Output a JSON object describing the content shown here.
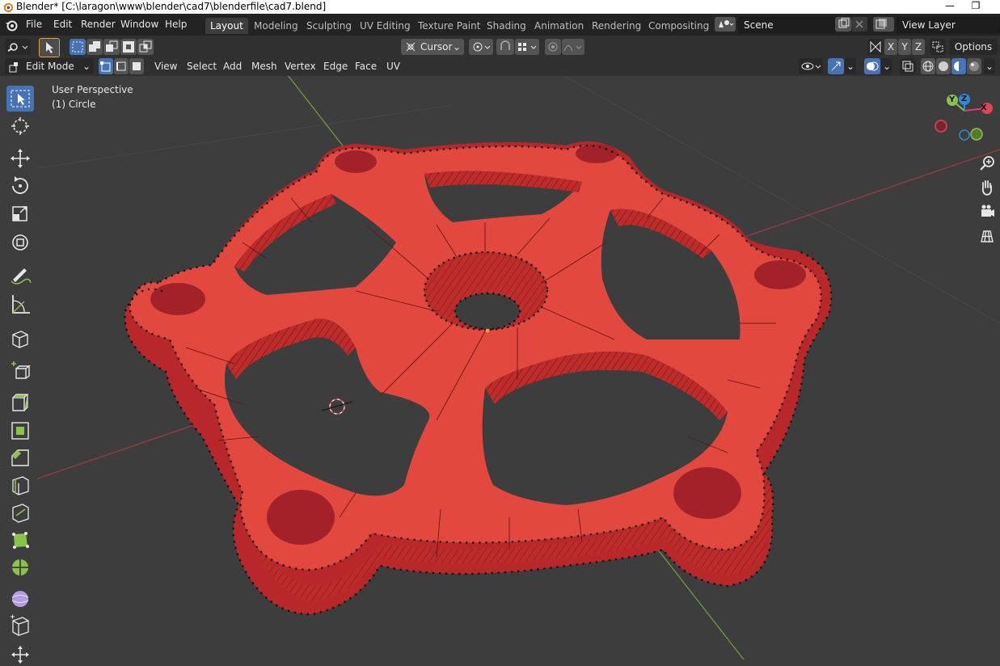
{
  "window": {
    "title": "Blender* [C:\\laragon\\www\\blender\\cad7\\blenderfile\\cad7.blend]",
    "minimize_glyph": "—",
    "maximize_glyph": "❐"
  },
  "menubar": {
    "items": [
      "File",
      "Edit",
      "Render",
      "Window",
      "Help"
    ],
    "workspaces": [
      "Layout",
      "Modeling",
      "Sculpting",
      "UV Editing",
      "Texture Paint",
      "Shading",
      "Animation",
      "Rendering",
      "Compositing"
    ],
    "active_workspace": "Layout",
    "scene": "Scene",
    "view_layer": "View Layer"
  },
  "header": {
    "transform_orientation": "Cursor",
    "axes": [
      "X",
      "Y",
      "Z"
    ],
    "options_label": "Options",
    "mode": "Edit Mode",
    "menus": [
      "View",
      "Select",
      "Add",
      "Mesh",
      "Vertex",
      "Edge",
      "Face",
      "UV"
    ]
  },
  "viewport": {
    "perspective_label": "User Perspective",
    "object_label": "(1) Circle",
    "gizmo_axes": [
      "X",
      "Y",
      "Z"
    ],
    "colors": {
      "background": "#3d3d3d",
      "mesh_face": "#e2483d",
      "mesh_face_dark": "#b8282a",
      "x_axis": "#9a3a44",
      "y_axis": "#6e9b3a",
      "x_gizmo": "#e04556",
      "y_gizmo": "#8bc34a",
      "z_gizmo": "#2b8ae0"
    }
  },
  "toolbar": {
    "tools": [
      "select-box",
      "cursor",
      "move",
      "rotate",
      "scale",
      "transform",
      "annotate",
      "measure",
      "add-cube",
      "extrude",
      "inset",
      "bevel",
      "loop-cut",
      "knife",
      "poly-build",
      "spin",
      "smooth",
      "shrink-fatten",
      "shear"
    ],
    "active_tool": "select-box"
  },
  "icons": {
    "app": "blender-logo-icon",
    "select_box": "select-box-icon",
    "cursor": "cursor-icon",
    "move": "move-icon",
    "rotate": "rotate-icon",
    "scale": "scale-icon",
    "transform": "transform-icon",
    "annotate": "annotate-icon",
    "measure": "measure-icon",
    "zoom": "zoom-icon",
    "pan": "hand-icon",
    "camera": "camera-icon",
    "grid": "grid-icon"
  }
}
